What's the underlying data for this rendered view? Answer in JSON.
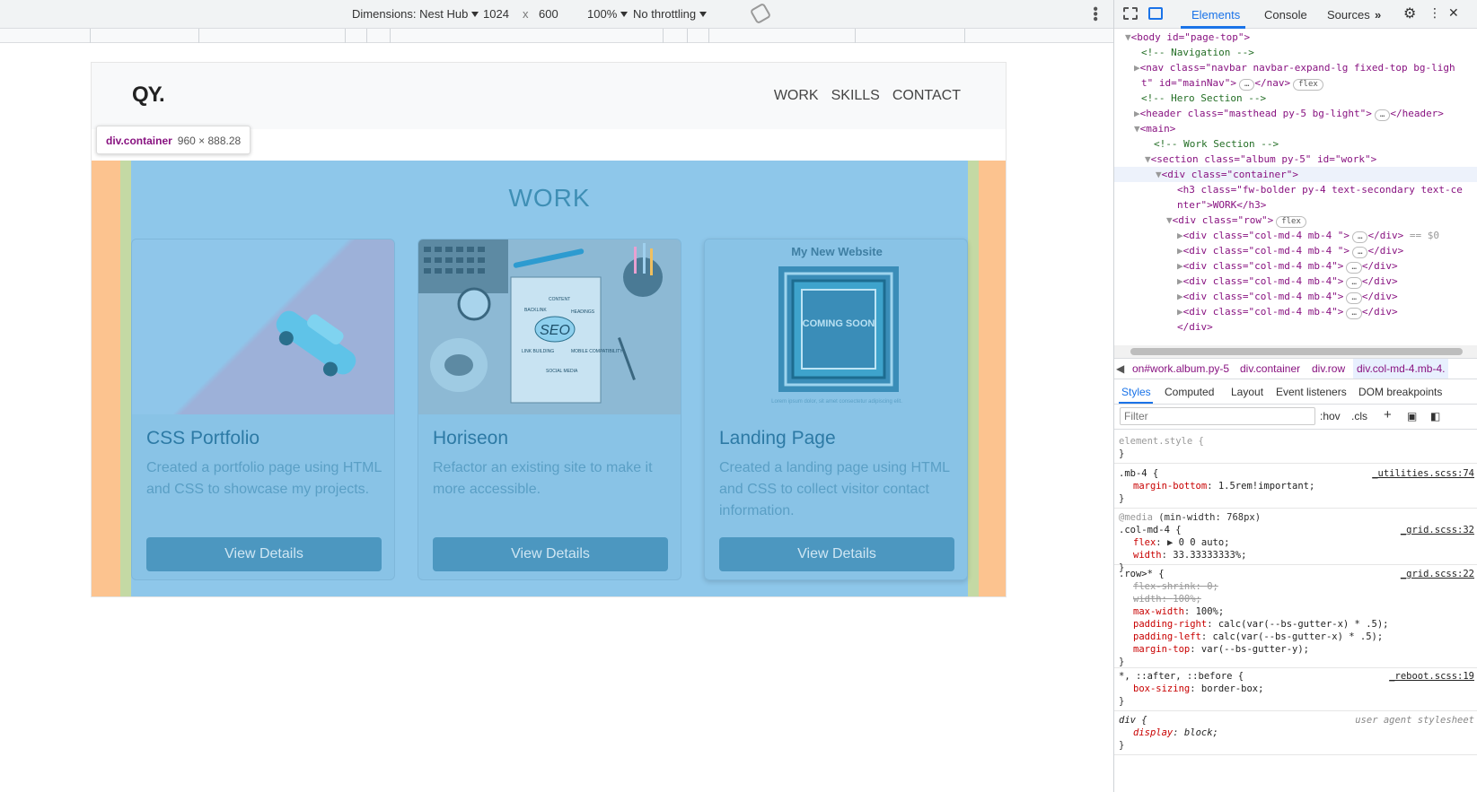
{
  "device_toolbar": {
    "device": "Dimensions: Nest Hub",
    "width": "1024",
    "x": "x",
    "height": "600",
    "zoom": "100%",
    "throttle": "No throttling"
  },
  "site": {
    "brand": "QY.",
    "nav": [
      "WORK",
      "SKILLS",
      "CONTACT"
    ],
    "section_title": "WORK",
    "cards": [
      {
        "title": "CSS Portfolio",
        "text": "Created a portfolio page using HTML and CSS to showcase my projects.",
        "button": "View Details"
      },
      {
        "title": "Horiseon",
        "text": "Refactor an existing site to make it more accessible.",
        "button": "View Details"
      },
      {
        "title": "Landing Page",
        "text": "Created a landing page using HTML and CSS to collect visitor contact information.",
        "button": "View Details",
        "image_heading": "My New Website",
        "image_badge": "COMING SOON",
        "image_caption": "Lorem ipsum dolor, sit amet consectetur adipiscing elit."
      }
    ],
    "seo_words": [
      "BACKLINK",
      "CONTENT",
      "HEADINGS",
      "SEO",
      "LINK BUILDING",
      "MOBILE COMPATIBILITY",
      "SOCIAL MEDIA"
    ]
  },
  "inspect_badge": {
    "name": "div.container",
    "size": "960 × 888.28"
  },
  "devtools": {
    "tabs": [
      "Elements",
      "Console",
      "Sources"
    ],
    "more": "»",
    "tree": [
      "<body id=\"page-top\">",
      "<!-- Navigation -->",
      "<nav class=\"navbar navbar-expand-lg fixed-top bg-ligh",
      "t\" id=\"mainNav\">",
      "</nav>",
      "<!-- Hero Section -->",
      "<header class=\"masthead py-5 bg-light\">",
      "</header>",
      "<main>",
      "<!-- Work Section -->",
      "<section class=\"album py-5\" id=\"work\">",
      "<div class=\"container\">",
      "<h3 class=\"fw-bolder py-4 text-secondary text-ce",
      "nter\">WORK</h3>",
      "<div class=\"row\">",
      "<div class=\"col-md-4 mb-4 \">",
      "</div>",
      "== $0",
      "<div class=\"col-md-4 mb-4 \">",
      "<div class=\"col-md-4 mb-4\">",
      "</div>",
      "flex",
      "…"
    ],
    "breadcrumbs": [
      "on#work.album.py-5",
      "div.container",
      "div.row",
      "div.col-md-4.mb-4."
    ],
    "subtabs": [
      "Styles",
      "Computed",
      "Layout",
      "Event listeners",
      "DOM breakpoints"
    ],
    "filter_placeholder": "Filter",
    "hov": ":hov",
    "cls": ".cls",
    "styles": {
      "element_style": "element.style {",
      "close": "}",
      "mb4_selector": ".mb-4 {",
      "mb4_src": "_utilities.scss:74",
      "mb4_prop": "margin-bottom",
      "mb4_val": "1.5rem!important;",
      "media": "@media",
      "media_q": "(min-width: 768px)",
      "col_selector": ".col-md-4 {",
      "col_src": "_grid.scss:32",
      "flex_prop": "flex",
      "flex_val": "0 0 auto;",
      "width_prop": "width",
      "width_val": "33.33333333%;",
      "row_selector": ".row>* {",
      "row_src": "_grid.scss:22",
      "fs_prop": "flex-shrink",
      "fs_val": "0;",
      "w_prop": "width",
      "w_val": "100%;",
      "mw_prop": "max-width",
      "mw_val": "100%;",
      "pr_prop": "padding-right",
      "pr_val": "calc(var(--bs-gutter-x) * .5);",
      "pl_prop": "padding-left",
      "pl_val": "calc(var(--bs-gutter-x) * .5);",
      "mt_prop": "margin-top",
      "mt_val": "var(--bs-gutter-y);",
      "univ_selector": "*, ::after, ::before {",
      "univ_src": "_reboot.scss:19",
      "bs_prop": "box-sizing",
      "bs_val": "border-box;",
      "div_selector": "div {",
      "div_src": "user agent stylesheet",
      "disp_prop": "display",
      "disp_val": "block;"
    }
  }
}
